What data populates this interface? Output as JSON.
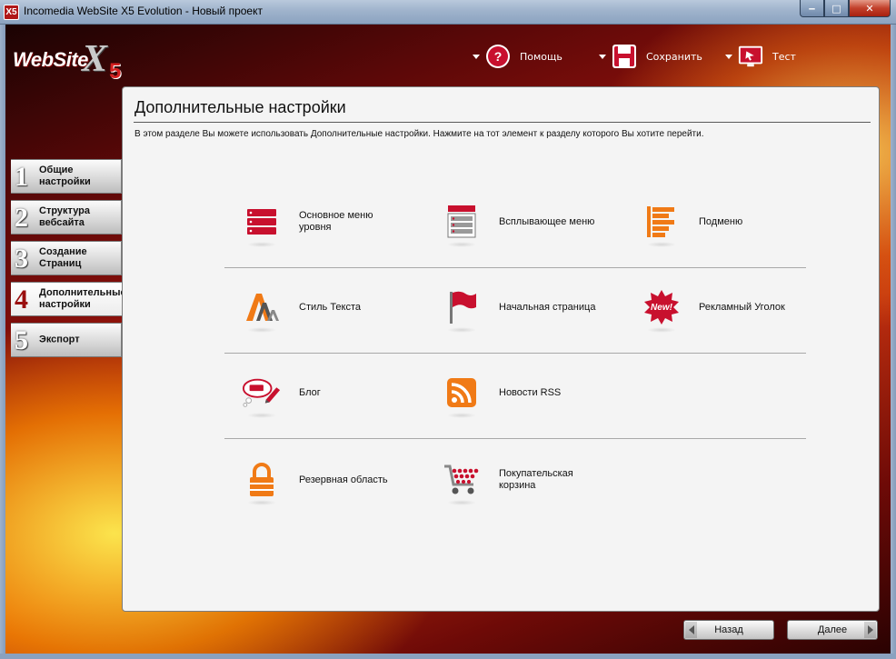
{
  "window": {
    "title": "Incomedia WebSite X5 Evolution - Новый проект",
    "app_icon": "X5",
    "minimize": "‒",
    "maximize": "□",
    "close": "✕"
  },
  "logo": {
    "word": "WebSite",
    "x": "X",
    "five": "5"
  },
  "toolbar": {
    "help": "Помощь",
    "save": "Сохранить",
    "test": "Тест"
  },
  "nav": {
    "items": [
      {
        "num": "1",
        "label": "Общие\nнастройки"
      },
      {
        "num": "2",
        "label": "Структура\nвебсайта"
      },
      {
        "num": "3",
        "label": "Создание\nСтраниц"
      },
      {
        "num": "4",
        "label": "Дополнительные\nнастройки",
        "active": true
      },
      {
        "num": "5",
        "label": "Экспорт"
      }
    ]
  },
  "panel": {
    "title": "Дополнительные настройки",
    "description": "В этом разделе Вы можете  использовать Дополнительные настройки. Нажмите на тот элемент к разделу которого Вы хотите перейти.",
    "tiles": {
      "main_menu": "Основное меню\nуровня",
      "popup_menu": "Всплывающее меню",
      "submenu": "Подменю",
      "text_style": "Стиль Текста",
      "home_page": "Начальная страница",
      "ad_corner": "Рекламный Уголок",
      "ad_badge": "New!",
      "blog": "Блог",
      "rss": "Новости RSS",
      "reserved_area": "Резервная область",
      "cart": "Покупательская\nкорзина"
    }
  },
  "footer": {
    "back": "Назад",
    "next": "Далее"
  },
  "colors": {
    "accent_red": "#c8102e",
    "accent_orange": "#f07a16"
  }
}
